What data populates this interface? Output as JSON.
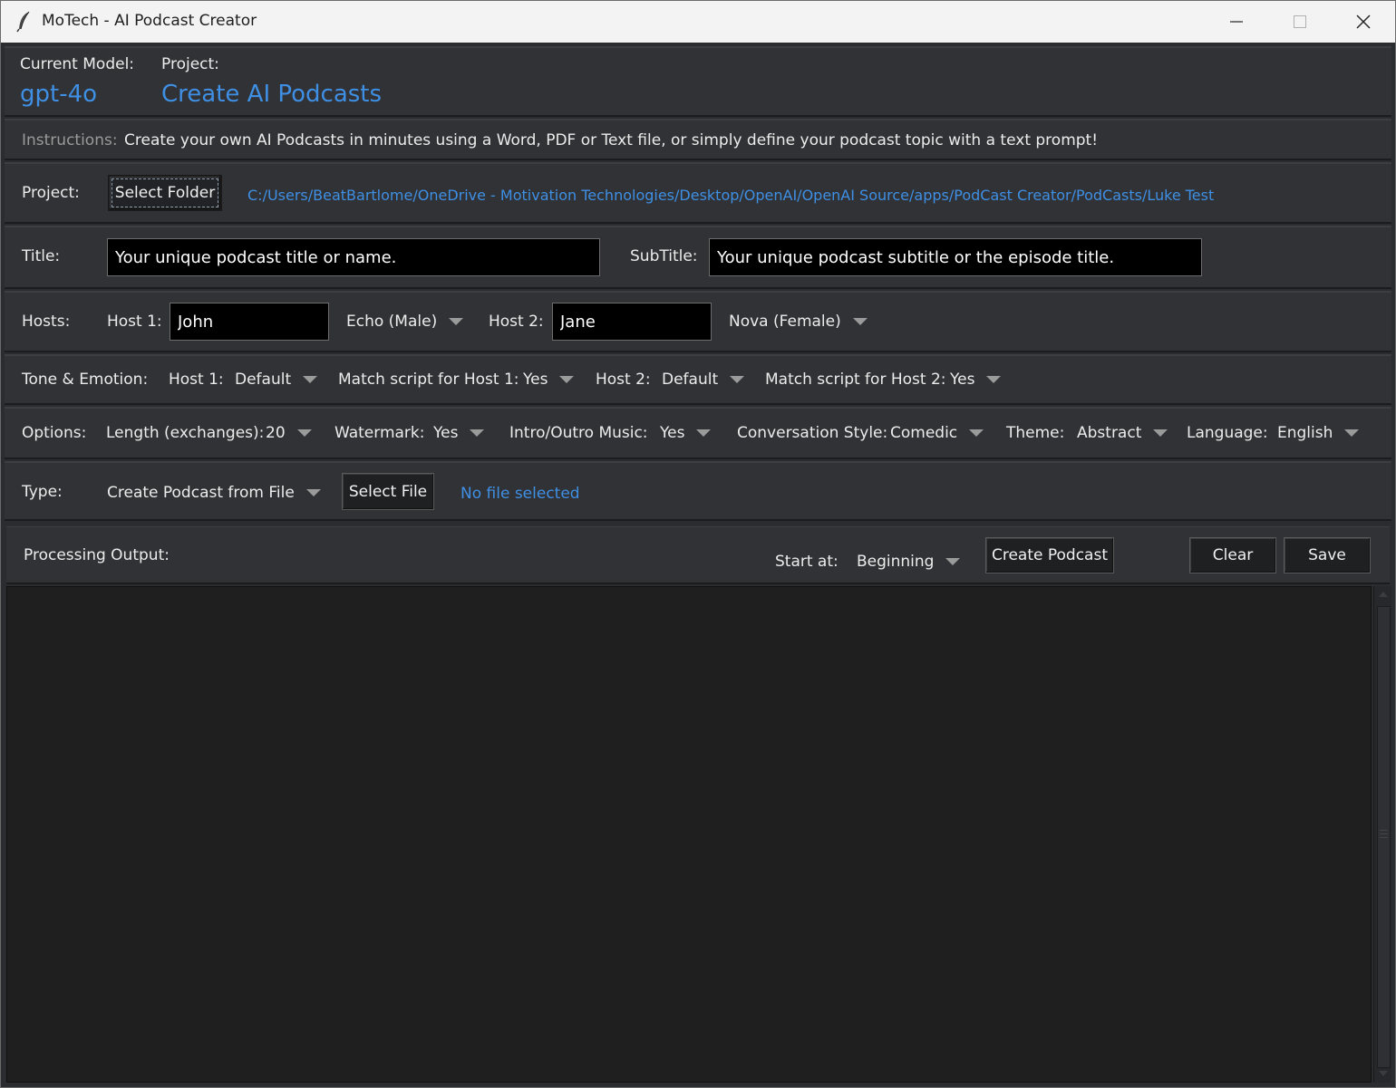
{
  "window": {
    "title": "MoTech - AI Podcast Creator"
  },
  "header": {
    "model_label": "Current Model:",
    "model_value": "gpt-4o",
    "project_label": "Project:",
    "project_value": "Create AI Podcasts"
  },
  "instructions": {
    "label": "Instructions:",
    "text": "Create your own AI Podcasts in minutes using a Word, PDF or Text file, or simply define your podcast topic with a text prompt!"
  },
  "project": {
    "label": "Project:",
    "button": "Select Folder",
    "path": "C:/Users/BeatBartlome/OneDrive - Motivation Technologies/Desktop/OpenAI/OpenAI Source/apps/PodCast Creator/PodCasts/Luke Test"
  },
  "titles": {
    "title_label": "Title:",
    "title_value": "Your unique podcast title or name.",
    "subtitle_label": "SubTitle:",
    "subtitle_value": "Your unique podcast subtitle or the episode title."
  },
  "hosts": {
    "label": "Hosts:",
    "host1_label": "Host 1:",
    "host1_name": "John",
    "host1_voice": "Echo (Male)",
    "host2_label": "Host 2:",
    "host2_name": "Jane",
    "host2_voice": "Nova (Female)"
  },
  "tone": {
    "label": "Tone & Emotion:",
    "host1_label": "Host 1:",
    "host1_value": "Default",
    "match1_label": "Match script for Host 1:",
    "match1_value": "Yes",
    "host2_label": "Host 2:",
    "host2_value": "Default",
    "match2_label": "Match script for Host 2:",
    "match2_value": "Yes"
  },
  "options": {
    "label": "Options:",
    "length_label": "Length (exchanges):",
    "length_value": "20",
    "watermark_label": "Watermark:",
    "watermark_value": "Yes",
    "music_label": "Intro/Outro Music:",
    "music_value": "Yes",
    "style_label": "Conversation Style:",
    "style_value": "Comedic",
    "theme_label": "Theme:",
    "theme_value": "Abstract",
    "language_label": "Language:",
    "language_value": "English"
  },
  "type": {
    "label": "Type:",
    "value": "Create Podcast from File",
    "button": "Select File",
    "file_status": "No file selected"
  },
  "processing": {
    "label": "Processing Output:",
    "start_label": "Start at:",
    "start_value": "Beginning",
    "create_button": "Create Podcast",
    "clear_button": "Clear",
    "save_button": "Save"
  },
  "colors": {
    "accent": "#3f8fe4",
    "background": "#303235",
    "output_bg": "#1f1f1f"
  }
}
